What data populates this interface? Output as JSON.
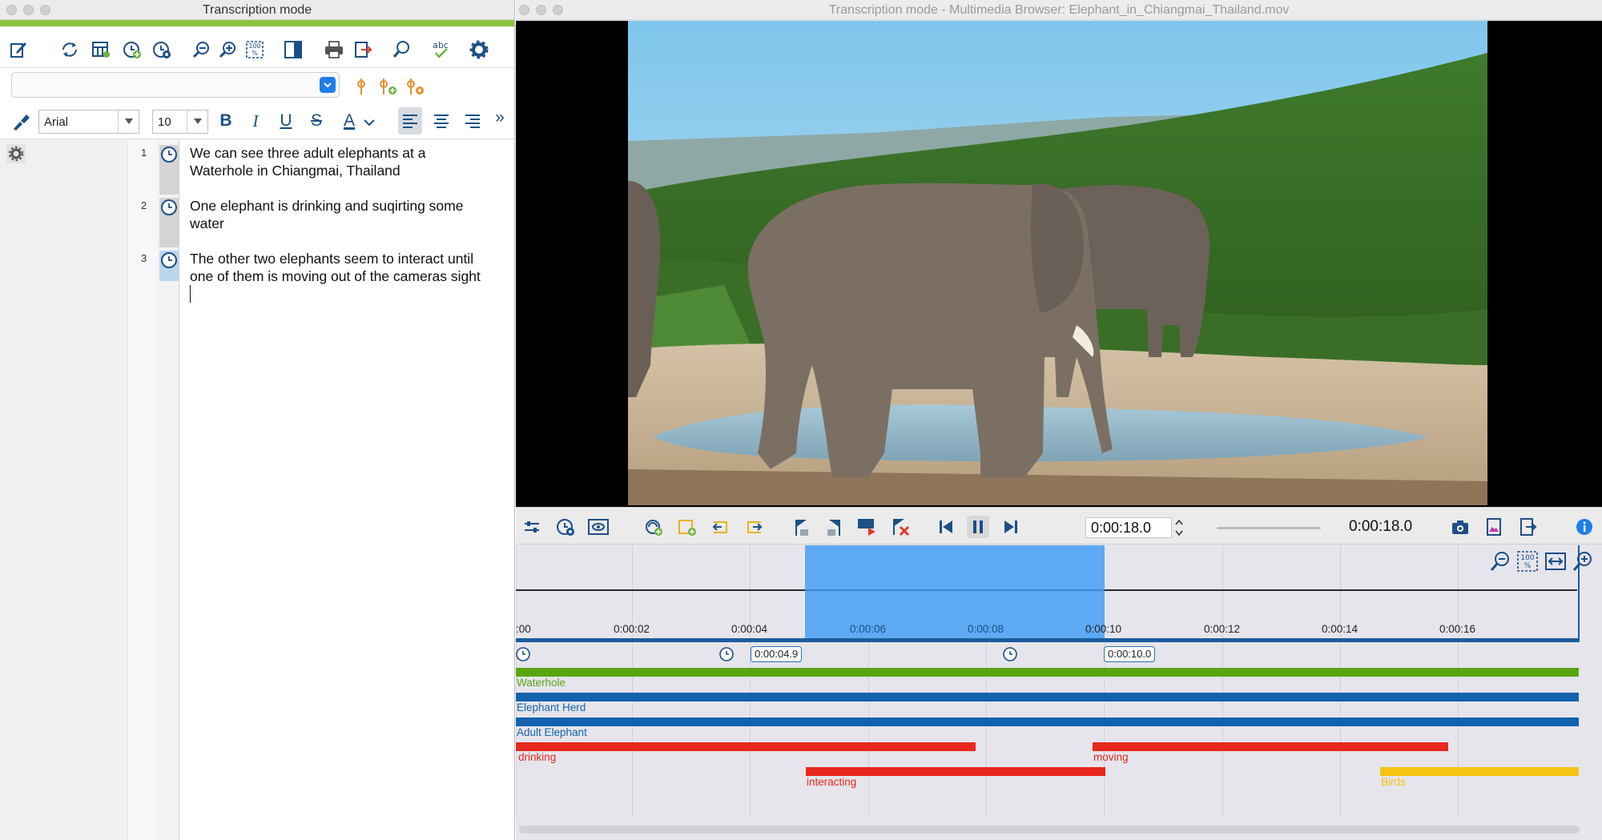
{
  "left_window": {
    "title": "Transcription mode",
    "toolbar_icons": [
      "edit-icon",
      "sync-icon",
      "table-icon",
      "add-timestamp-icon",
      "timestamp-settings-icon",
      "zoom-out-icon",
      "zoom-in-icon",
      "zoom-100-icon",
      "view-panel-icon",
      "print-icon",
      "export-icon",
      "search-icon",
      "spellcheck-icon",
      "settings-icon"
    ],
    "spellcheck_text": "abc",
    "zoom_text": "100",
    "context_dropdown": {
      "value": ""
    },
    "format": {
      "font_family": "Arial",
      "font_size": "10",
      "bold": "B",
      "italic": "I",
      "underline": "U",
      "strike": "S",
      "text_color_label": "A",
      "more": "»",
      "alignment_active": "left"
    },
    "paragraphs": [
      {
        "num": "1",
        "line1": "We can see three adult elephants at a",
        "line2": "Waterhole in Chiangmai, Thailand"
      },
      {
        "num": "2",
        "line1": "One elephant is drinking and suqirting some",
        "line2": "water"
      },
      {
        "num": "3",
        "line1": "The other two elephants seem to interact until",
        "line2": "one of them is moving out of the cameras sight"
      }
    ]
  },
  "right_window": {
    "title": "Transcription mode - Multimedia Browser:  Elephant_in_Chiangmai_Thailand.mov",
    "current_time_input": "0:00:18.0",
    "current_time_display": "0:00:18.0",
    "volume": 0.0,
    "zoom_label": "100",
    "timeline": {
      "ticks": [
        ":00",
        "0:00:02",
        "0:00:04",
        "0:00:06",
        "0:00:08",
        "0:00:10",
        "0:00:12",
        "0:00:14",
        "0:00:16"
      ],
      "selection": {
        "start": "0:00:04.9",
        "end": "0:00:10.0"
      },
      "timestamp_pills": [
        "0:00:04.9",
        "0:00:10.0"
      ],
      "codes": [
        {
          "label": "Waterhole",
          "color": "#5aa512"
        },
        {
          "label": "Elephant Herd",
          "color": "#1362ad"
        },
        {
          "label": "Adult Elephant",
          "color": "#1362ad"
        },
        {
          "label": "drinking",
          "color": "#e8281e"
        },
        {
          "label": "moving",
          "color": "#e8281e"
        },
        {
          "label": "interacting",
          "color": "#e8281e"
        },
        {
          "label": "Birds",
          "color": "#f5c213"
        }
      ]
    }
  },
  "colors": {
    "accent_green": "#8cc33f",
    "toolbar_blue": "#1c4f86",
    "selection_blue": "#409cf5"
  }
}
